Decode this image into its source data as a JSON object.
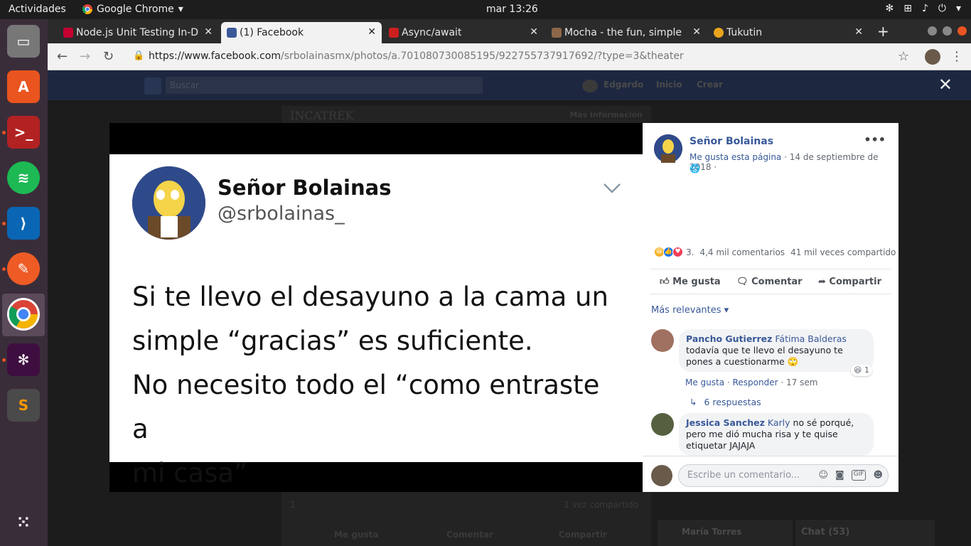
{
  "ubuntu": {
    "activities": "Actividades",
    "app_name": "Google Chrome",
    "clock": "mar 13:26"
  },
  "browser": {
    "tabs": [
      {
        "title": "Node.js Unit Testing In-D",
        "favicon_color": "#c3002f"
      },
      {
        "title": "(1) Facebook",
        "favicon_color": "#3b5998"
      },
      {
        "title": "Async/await",
        "favicon_color": "#cc1f1f"
      },
      {
        "title": "Mocha - the fun, simple, f",
        "favicon_color": "#8d6748"
      },
      {
        "title": "Tukutin",
        "favicon_color": "#e8a41c"
      }
    ],
    "new_tab": "+",
    "url_host": "https://www.facebook.com",
    "url_path": "/srbolainasmx/photos/a.701080730085195/922755737917692/?type=3&theater"
  },
  "background": {
    "search_placeholder": "Buscar",
    "nav_user": "Edgardo",
    "nav_home": "Inicio",
    "nav_create": "Crear",
    "page_title": "INCATREK",
    "more_info": "Más información",
    "bottom_like": "Me gusta",
    "bottom_comment": "Comentar",
    "bottom_share": "Compartir",
    "shared_once": "1 vez compartido",
    "reaction_count": "1",
    "chat_person": "María Torres",
    "chat_label": "Chat (53)"
  },
  "tweet": {
    "name": "Señor Bolainas",
    "handle": "@srbolainas_",
    "line1": "Si te llevo el desayuno a la cama un",
    "line2": "simple “gracias” es suficiente.",
    "line3": "No necesito todo el “como entraste a",
    "line4": "mi casa”"
  },
  "post": {
    "page_name": "Señor Bolainas",
    "like_page": "Me gusta esta página",
    "date": "14 de septiembre de 2018",
    "reaction_count": "3.",
    "comments": "4,4 mil comentarios",
    "shares": "41 mil veces compartido",
    "like": "Me gusta",
    "comment": "Comentar",
    "share": "Compartir",
    "sort": "Más relevantes"
  },
  "comments": [
    {
      "author": "Pancho Gutierrez",
      "tag": "Fátima Balderas",
      "text": "todavía que te llevo el desayuno te pones a cuestionarme 🙄",
      "like": "Me gusta",
      "reply": "Responder",
      "time": "17 sem",
      "reactions": "1",
      "replies": "6 respuestas"
    },
    {
      "author": "Jessica Sanchez",
      "tag": "Karly",
      "text": "no sé porqué, pero me dió mucha risa y te quise etiquetar JAJAJA"
    }
  ],
  "composer": {
    "placeholder": "Escribe un comentario..."
  }
}
